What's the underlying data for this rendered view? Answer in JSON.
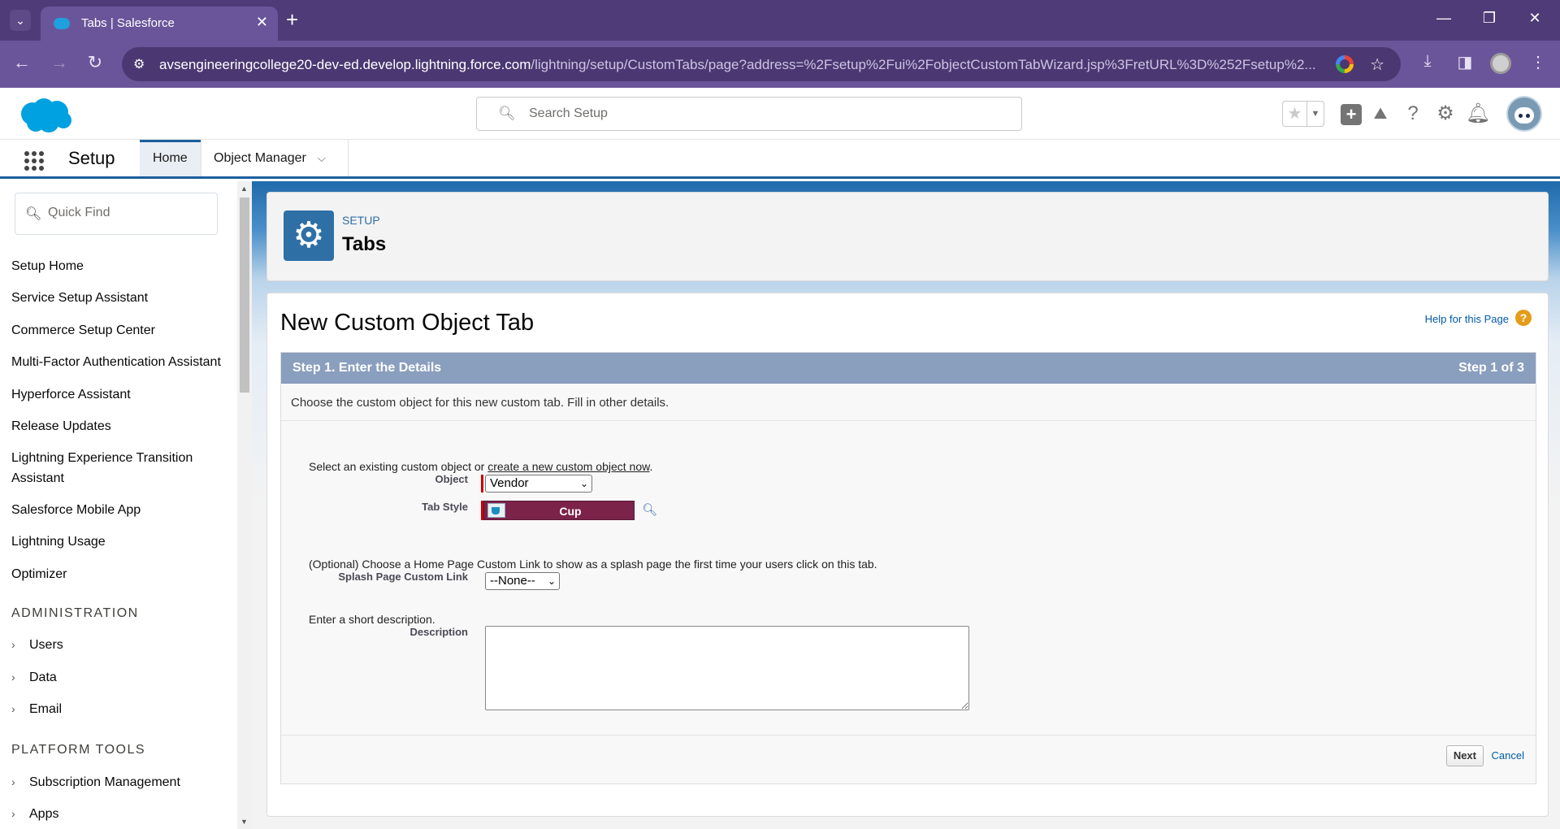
{
  "browser": {
    "tab_title": "Tabs | Salesforce",
    "url_host": "avsengineeringcollege20-dev-ed.develop.lightning.force.com",
    "url_path": "/lightning/setup/CustomTabs/page?address=%2Fsetup%2Fui%2FobjectCustomTabWizard.jsp%3FretURL%3D%252Fsetup%2..."
  },
  "header": {
    "search_placeholder": "Search Setup"
  },
  "context_bar": {
    "app_name": "Setup",
    "tabs": [
      "Home",
      "Object Manager"
    ]
  },
  "sidebar": {
    "quick_find_placeholder": "Quick Find",
    "items": [
      "Setup Home",
      "Service Setup Assistant",
      "Commerce Setup Center",
      "Multi-Factor Authentication Assistant",
      "Hyperforce Assistant",
      "Release Updates",
      "Lightning Experience Transition Assistant",
      "Salesforce Mobile App",
      "Lightning Usage",
      "Optimizer"
    ],
    "administration_heading": "ADMINISTRATION",
    "administration_items": [
      "Users",
      "Data",
      "Email"
    ],
    "platform_heading": "PLATFORM TOOLS",
    "platform_items": [
      "Subscription Management",
      "Apps"
    ]
  },
  "page_header": {
    "label": "SETUP",
    "title": "Tabs"
  },
  "form": {
    "title": "New Custom Object Tab",
    "help_link": "Help for this Page",
    "step_title": "Step 1. Enter the Details",
    "step_counter": "Step 1 of 3",
    "intro": "Choose the custom object for this new custom tab. Fill in other details.",
    "object_prompt_prefix": "Select an existing custom object or ",
    "object_prompt_link": "create a new custom object now",
    "object_prompt_suffix": ".",
    "object_label": "Object",
    "object_value": "Vendor",
    "tab_style_label": "Tab Style",
    "tab_style_value": "Cup",
    "splash_prompt": "(Optional) Choose a Home Page Custom Link to show as a splash page the first time your users click on this tab.",
    "splash_label": "Splash Page Custom Link",
    "splash_value": "--None--",
    "description_prompt": "Enter a short description.",
    "description_label": "Description",
    "description_value": "",
    "next_label": "Next",
    "cancel_label": "Cancel"
  },
  "colors": {
    "browser_frame": "#4f3b78",
    "tab_style_swatch": "#7b2349",
    "step_bar": "#8a9ebe",
    "setup_icon": "#2e6fa6"
  }
}
